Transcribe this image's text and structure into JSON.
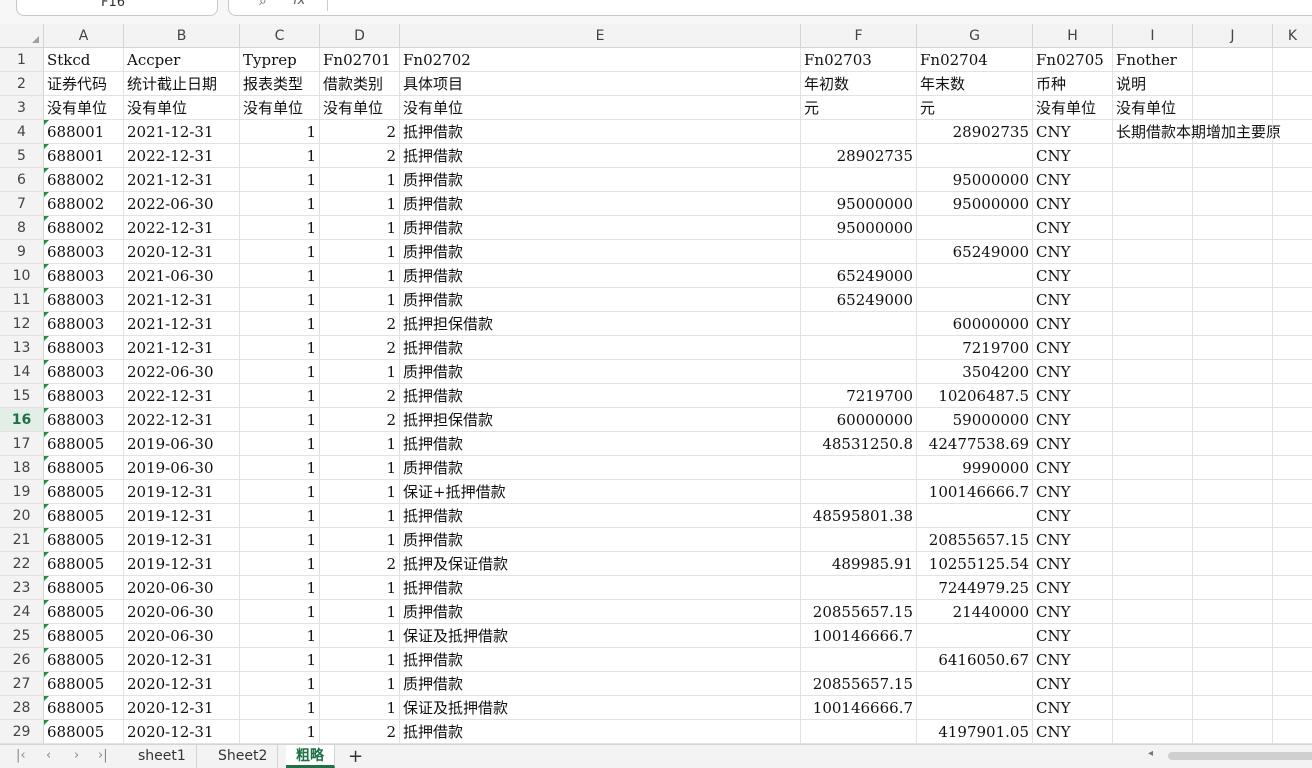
{
  "name_box": "F16",
  "formula_bar": {
    "search_icon": "magnifier-icon",
    "fx_label": "fx",
    "value": ""
  },
  "columns": [
    "A",
    "B",
    "C",
    "D",
    "E",
    "F",
    "G",
    "H",
    "I",
    "J",
    "K"
  ],
  "rows": [
    {
      "n": "1",
      "cells": [
        "Stkcd",
        "Accper",
        "Typrep",
        "Fn02701",
        "Fn02702",
        "Fn02703",
        "Fn02704",
        "Fn02705",
        "Fnother"
      ]
    },
    {
      "n": "2",
      "cells": [
        "证券代码",
        "统计截止日期",
        "报表类型",
        "借款类别",
        "具体项目",
        "年初数",
        "年末数",
        "币种",
        "说明"
      ]
    },
    {
      "n": "3",
      "cells": [
        "没有单位",
        "没有单位",
        "没有单位",
        "没有单位",
        "没有单位",
        "元",
        "元",
        "没有单位",
        "没有单位"
      ]
    },
    {
      "n": "4",
      "cells": [
        "688001",
        "2021-12-31",
        "1",
        "2",
        "抵押借款",
        "",
        "28902735",
        "CNY",
        "长期借款本期增加主要原"
      ]
    },
    {
      "n": "5",
      "cells": [
        "688001",
        "2022-12-31",
        "1",
        "2",
        "抵押借款",
        "28902735",
        "",
        "CNY",
        ""
      ]
    },
    {
      "n": "6",
      "cells": [
        "688002",
        "2021-12-31",
        "1",
        "1",
        "质押借款",
        "",
        "95000000",
        "CNY",
        ""
      ]
    },
    {
      "n": "7",
      "cells": [
        "688002",
        "2022-06-30",
        "1",
        "1",
        "质押借款",
        "95000000",
        "95000000",
        "CNY",
        ""
      ]
    },
    {
      "n": "8",
      "cells": [
        "688002",
        "2022-12-31",
        "1",
        "1",
        "质押借款",
        "95000000",
        "",
        "CNY",
        ""
      ]
    },
    {
      "n": "9",
      "cells": [
        "688003",
        "2020-12-31",
        "1",
        "1",
        "质押借款",
        "",
        "65249000",
        "CNY",
        ""
      ]
    },
    {
      "n": "10",
      "cells": [
        "688003",
        "2021-06-30",
        "1",
        "1",
        "质押借款",
        "65249000",
        "",
        "CNY",
        ""
      ]
    },
    {
      "n": "11",
      "cells": [
        "688003",
        "2021-12-31",
        "1",
        "1",
        "质押借款",
        "65249000",
        "",
        "CNY",
        ""
      ]
    },
    {
      "n": "12",
      "cells": [
        "688003",
        "2021-12-31",
        "1",
        "2",
        "抵押担保借款",
        "",
        "60000000",
        "CNY",
        ""
      ]
    },
    {
      "n": "13",
      "cells": [
        "688003",
        "2021-12-31",
        "1",
        "2",
        "抵押借款",
        "",
        "7219700",
        "CNY",
        ""
      ]
    },
    {
      "n": "14",
      "cells": [
        "688003",
        "2022-06-30",
        "1",
        "1",
        "质押借款",
        "",
        "3504200",
        "CNY",
        ""
      ]
    },
    {
      "n": "15",
      "cells": [
        "688003",
        "2022-12-31",
        "1",
        "2",
        "抵押借款",
        "7219700",
        "10206487.5",
        "CNY",
        ""
      ]
    },
    {
      "n": "16",
      "cells": [
        "688003",
        "2022-12-31",
        "1",
        "2",
        "抵押担保借款",
        "60000000",
        "59000000",
        "CNY",
        ""
      ]
    },
    {
      "n": "17",
      "cells": [
        "688005",
        "2019-06-30",
        "1",
        "1",
        "抵押借款",
        "48531250.8",
        "42477538.69",
        "CNY",
        ""
      ]
    },
    {
      "n": "18",
      "cells": [
        "688005",
        "2019-06-30",
        "1",
        "1",
        "质押借款",
        "",
        "9990000",
        "CNY",
        ""
      ]
    },
    {
      "n": "19",
      "cells": [
        "688005",
        "2019-12-31",
        "1",
        "1",
        "保证+抵押借款",
        "",
        "100146666.7",
        "CNY",
        ""
      ]
    },
    {
      "n": "20",
      "cells": [
        "688005",
        "2019-12-31",
        "1",
        "1",
        "抵押借款",
        "48595801.38",
        "",
        "CNY",
        ""
      ]
    },
    {
      "n": "21",
      "cells": [
        "688005",
        "2019-12-31",
        "1",
        "1",
        "质押借款",
        "",
        "20855657.15",
        "CNY",
        ""
      ]
    },
    {
      "n": "22",
      "cells": [
        "688005",
        "2019-12-31",
        "1",
        "2",
        "抵押及保证借款",
        "489985.91",
        "10255125.54",
        "CNY",
        ""
      ]
    },
    {
      "n": "23",
      "cells": [
        "688005",
        "2020-06-30",
        "1",
        "1",
        "抵押借款",
        "",
        "7244979.25",
        "CNY",
        ""
      ]
    },
    {
      "n": "24",
      "cells": [
        "688005",
        "2020-06-30",
        "1",
        "1",
        "质押借款",
        "20855657.15",
        "21440000",
        "CNY",
        ""
      ]
    },
    {
      "n": "25",
      "cells": [
        "688005",
        "2020-06-30",
        "1",
        "1",
        "保证及抵押借款",
        "100146666.7",
        "",
        "CNY",
        ""
      ]
    },
    {
      "n": "26",
      "cells": [
        "688005",
        "2020-12-31",
        "1",
        "1",
        "抵押借款",
        "",
        "6416050.67",
        "CNY",
        ""
      ]
    },
    {
      "n": "27",
      "cells": [
        "688005",
        "2020-12-31",
        "1",
        "1",
        "质押借款",
        "20855657.15",
        "",
        "CNY",
        ""
      ]
    },
    {
      "n": "28",
      "cells": [
        "688005",
        "2020-12-31",
        "1",
        "1",
        "保证及抵押借款",
        "100146666.7",
        "",
        "CNY",
        ""
      ]
    },
    {
      "n": "29",
      "cells": [
        "688005",
        "2020-12-31",
        "1",
        "2",
        "抵押借款",
        "",
        "4197901.05",
        "CNY",
        ""
      ]
    }
  ],
  "active_row": "16",
  "sheet_tabs": [
    {
      "label": "sheet1",
      "active": false
    },
    {
      "label": "Sheet2",
      "active": false
    },
    {
      "label": "粗略",
      "active": true
    }
  ],
  "add_sheet_label": "+",
  "accent_color": "#1e7145"
}
